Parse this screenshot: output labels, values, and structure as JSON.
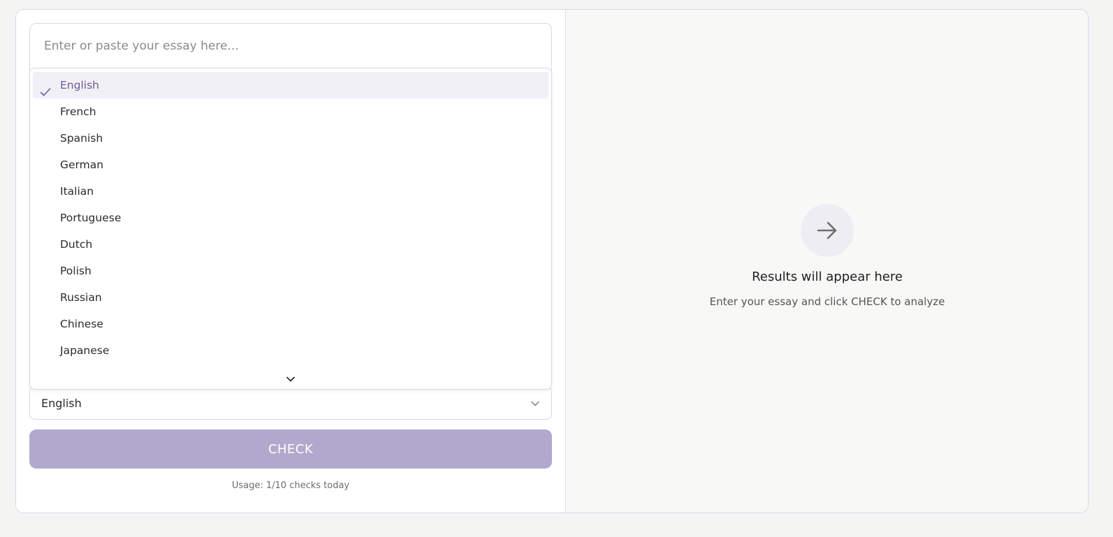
{
  "essay": {
    "placeholder": "Enter or paste your essay here...",
    "value": ""
  },
  "language_dropdown": {
    "selected": "English",
    "options": [
      "English",
      "French",
      "Spanish",
      "German",
      "Italian",
      "Portuguese",
      "Dutch",
      "Polish",
      "Russian",
      "Chinese",
      "Japanese"
    ],
    "check_icon": "check-icon",
    "scroll_icon": "chevron-down-icon"
  },
  "language_select": {
    "value": "English",
    "icon": "chevron-down-icon"
  },
  "check_button": {
    "label": "CHECK",
    "color": "#b1a9cd"
  },
  "usage": {
    "text": "Usage: 1/10 checks today"
  },
  "results": {
    "icon": "arrow-right-icon",
    "title": "Results will appear here",
    "subtitle": "Enter your essay and click CHECK to analyze"
  },
  "colors": {
    "accent": "#6b5b95",
    "selected_bg": "#f2f0f7",
    "border": "#d8d7e8",
    "right_panel_bg": "#f8f8f7"
  }
}
